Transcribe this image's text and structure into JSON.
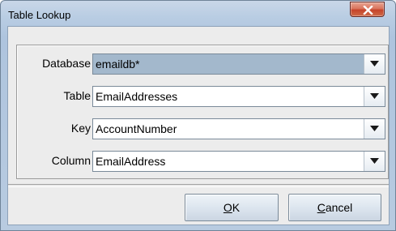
{
  "window": {
    "title": "Table Lookup",
    "close_icon": "close-x-icon"
  },
  "fields": [
    {
      "label": "Database",
      "value": "emaildb*",
      "selected": true
    },
    {
      "label": "Table",
      "value": "EmailAddresses",
      "selected": false
    },
    {
      "label": "Key",
      "value": "AccountNumber",
      "selected": false
    },
    {
      "label": "Column",
      "value": "EmailAddress",
      "selected": false
    }
  ],
  "dropdown_icon": "chevron-down-icon",
  "buttons": {
    "ok": {
      "mnemonic": "O",
      "rest": "K"
    },
    "cancel": {
      "mnemonic": "C",
      "rest": "ancel"
    }
  },
  "colors": {
    "selected_field": "#a3b8cc",
    "close_button": "#c5442a"
  }
}
